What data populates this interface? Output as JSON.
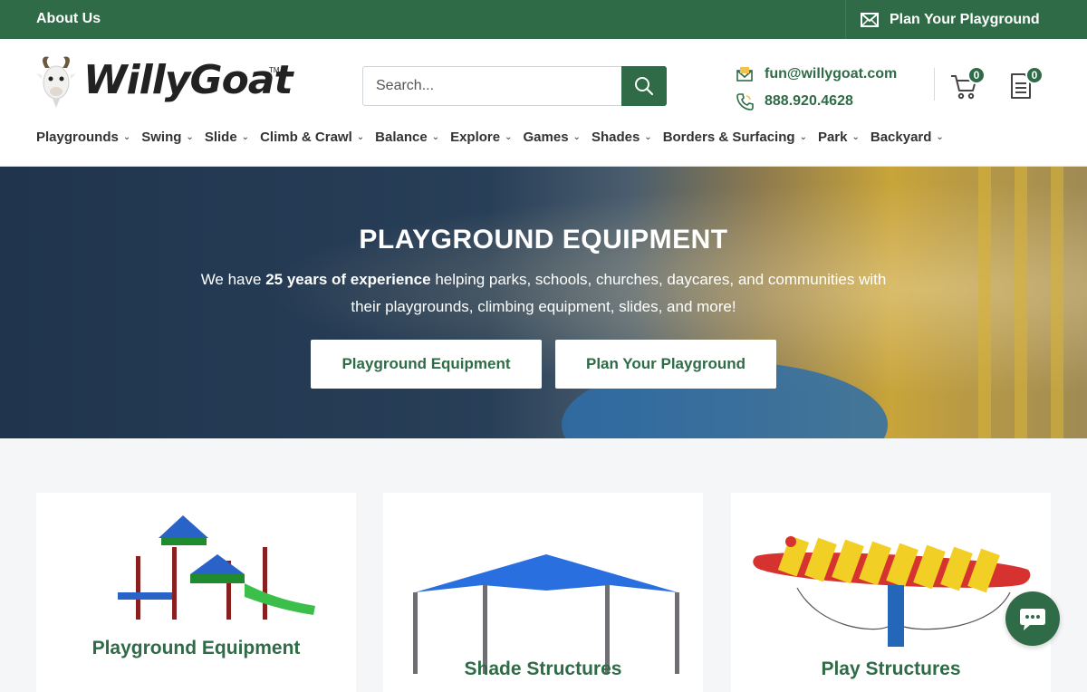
{
  "topbar": {
    "about_label": "About Us",
    "plan_label": "Plan Your Playground"
  },
  "header": {
    "logo_text": "WillyGoat",
    "logo_tm": "TM",
    "search_placeholder": "Search...",
    "email": "fun@willygoat.com",
    "phone": "888.920.4628",
    "cart_count": "0",
    "quote_count": "0"
  },
  "nav": {
    "items": [
      {
        "label": "Playgrounds"
      },
      {
        "label": "Swing"
      },
      {
        "label": "Slide"
      },
      {
        "label": "Climb & Crawl"
      },
      {
        "label": "Balance"
      },
      {
        "label": "Explore"
      },
      {
        "label": "Games"
      },
      {
        "label": "Shades"
      },
      {
        "label": "Borders & Surfacing"
      },
      {
        "label": "Park"
      },
      {
        "label": "Backyard"
      }
    ]
  },
  "hero": {
    "title": "PLAYGROUND EQUIPMENT",
    "desc_pre": "We have ",
    "desc_bold": "25 years of experience",
    "desc_post": " helping parks, schools, churches, daycares, and communities with their playgrounds, climbing equipment, slides, and more!",
    "cta_primary": "Playground Equipment",
    "cta_secondary": "Plan Your Playground"
  },
  "cards": [
    {
      "title": "Playground Equipment"
    },
    {
      "title": "Shade Structures"
    },
    {
      "title": "Play Structures"
    }
  ],
  "colors": {
    "brand_green": "#2e6b46",
    "hero_dark": "#20344d"
  }
}
